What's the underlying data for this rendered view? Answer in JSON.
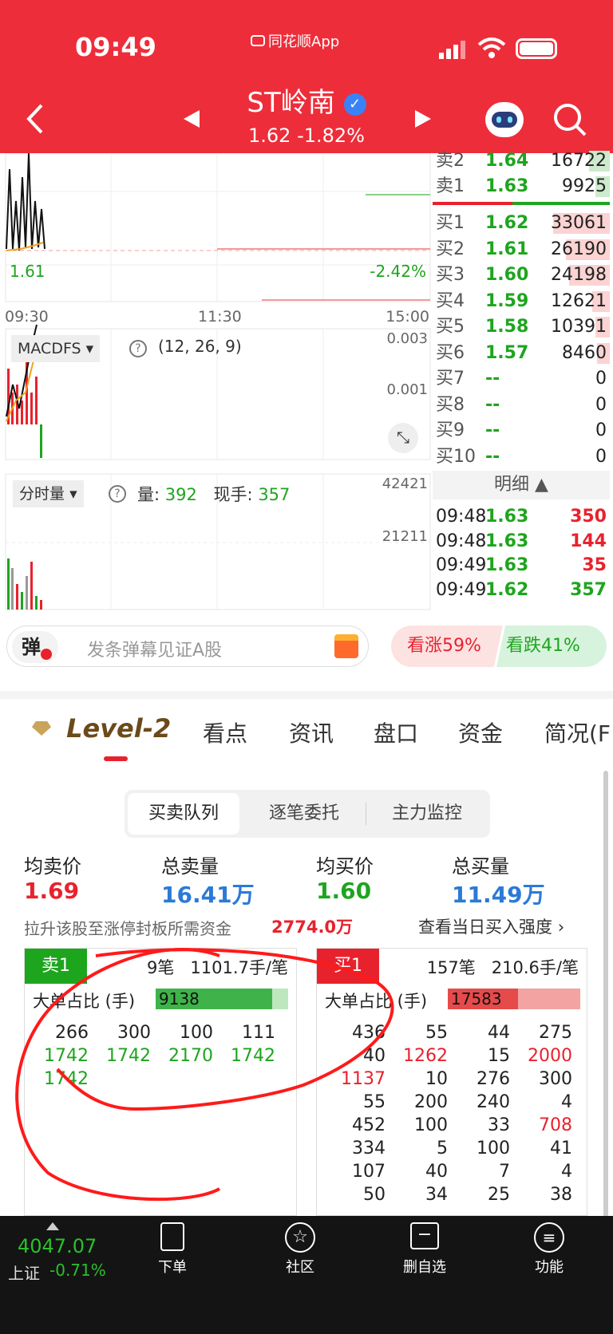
{
  "status_bar": {
    "time": "09:49",
    "app_badge": "同花顺App"
  },
  "header": {
    "stock_name": "ST岭南",
    "price_change": "1.62 -1.82%"
  },
  "chart": {
    "price_label_left": "1.61",
    "pct_label_right": "-2.42%",
    "time_axis": [
      "09:30",
      "11:30",
      "15:00"
    ],
    "macd": {
      "name": "MACDFS",
      "params": "(12, 26, 9)",
      "y_top": "0.003",
      "y_mid": "0.001"
    },
    "volume": {
      "name": "分时量",
      "vol_label": "量:",
      "vol_value": "392",
      "hand_label": "现手:",
      "hand_value": "357",
      "y_top": "42421",
      "y_mid": "21211"
    }
  },
  "order_book": {
    "asks": [
      {
        "label": "卖2",
        "price": "1.64",
        "volume": "16722",
        "fill": 0.12
      },
      {
        "label": "卖1",
        "price": "1.63",
        "volume": "9925",
        "fill": 0.08
      }
    ],
    "bids": [
      {
        "label": "买1",
        "price": "1.62",
        "volume": "33061",
        "fill": 0.32
      },
      {
        "label": "买2",
        "price": "1.61",
        "volume": "26190",
        "fill": 0.25
      },
      {
        "label": "买3",
        "price": "1.60",
        "volume": "24198",
        "fill": 0.23
      },
      {
        "label": "买4",
        "price": "1.59",
        "volume": "12621",
        "fill": 0.1
      },
      {
        "label": "买5",
        "price": "1.58",
        "volume": "10391",
        "fill": 0.08
      },
      {
        "label": "买6",
        "price": "1.57",
        "volume": "8460",
        "fill": 0.07
      },
      {
        "label": "买7",
        "price": "--",
        "volume": "0",
        "fill": 0
      },
      {
        "label": "买8",
        "price": "--",
        "volume": "0",
        "fill": 0
      },
      {
        "label": "买9",
        "price": "--",
        "volume": "0",
        "fill": 0
      },
      {
        "label": "买10",
        "price": "--",
        "volume": "0",
        "fill": 0
      }
    ],
    "detail_label": "明细"
  },
  "ticks": [
    {
      "time": "09:48",
      "price": "1.63",
      "vol": "350",
      "color": "#e8222d"
    },
    {
      "time": "09:48",
      "price": "1.63",
      "vol": "144",
      "color": "#e8222d"
    },
    {
      "time": "09:49",
      "price": "1.63",
      "vol": "35",
      "color": "#e8222d"
    },
    {
      "time": "09:49",
      "price": "1.62",
      "vol": "357",
      "color": "#1ea51e"
    }
  ],
  "danmu": {
    "icon_text": "弹",
    "placeholder": "发条弹幕见证A股"
  },
  "sentiment": {
    "up": "看涨59%",
    "down": "看跌41%"
  },
  "tabs": {
    "level2": "Level-2",
    "items": [
      "看点",
      "资讯",
      "盘口",
      "资金",
      "简况(F"
    ]
  },
  "segments": [
    "买卖队列",
    "逐笔委托",
    "主力监控"
  ],
  "stats": {
    "avg_sell_label": "均卖价",
    "avg_sell": "1.69",
    "total_sell_label": "总卖量",
    "total_sell": "16.41万",
    "avg_buy_label": "均买价",
    "avg_buy": "1.60",
    "total_buy_label": "总买量",
    "total_buy": "11.49万"
  },
  "limit_up": {
    "text": "拉升该股至涨停封板所需资金",
    "value": "2774.0万",
    "link": "查看当日买入强度"
  },
  "sell_queue": {
    "tag": "卖1",
    "summary": "9笔   1101.7手/笔",
    "big_label": "大单占比 (手)",
    "big_value": "9138",
    "fill": 0.88,
    "rows": [
      [
        "266",
        "300",
        "100",
        "111"
      ],
      [
        "1742",
        "1742",
        "2170",
        "1742"
      ],
      [
        "1742",
        "",
        "",
        ""
      ]
    ],
    "row_colors": [
      "#222",
      "#1ea51e",
      "#1ea51e"
    ]
  },
  "buy_queue": {
    "tag": "买1",
    "summary": "157笔   210.6手/笔",
    "big_label": "大单占比 (手)",
    "big_value": "17583",
    "fill": 0.53,
    "rows": [
      [
        "436",
        "55",
        "44",
        "275"
      ],
      [
        "40",
        "1262",
        "15",
        "2000"
      ],
      [
        "1137",
        "10",
        "276",
        "300"
      ],
      [
        "55",
        "200",
        "240",
        "4"
      ],
      [
        "452",
        "100",
        "33",
        "708"
      ],
      [
        "334",
        "5",
        "100",
        "41"
      ],
      [
        "107",
        "40",
        "7",
        "4"
      ],
      [
        "50",
        "34",
        "25",
        "38"
      ]
    ],
    "red_cells": [
      "1.1",
      "1.3",
      "2.0",
      "4.3"
    ]
  },
  "bottom_nav": {
    "index_value": "4047.07",
    "index_name": "上证",
    "index_pct": "-0.71%",
    "items": [
      "下单",
      "社区",
      "删自选",
      "功能"
    ]
  },
  "colors": {
    "brand_red": "#ee2d3a",
    "up_red": "#e8222d",
    "down_green": "#1ea51e",
    "blue": "#2b7ad6"
  }
}
